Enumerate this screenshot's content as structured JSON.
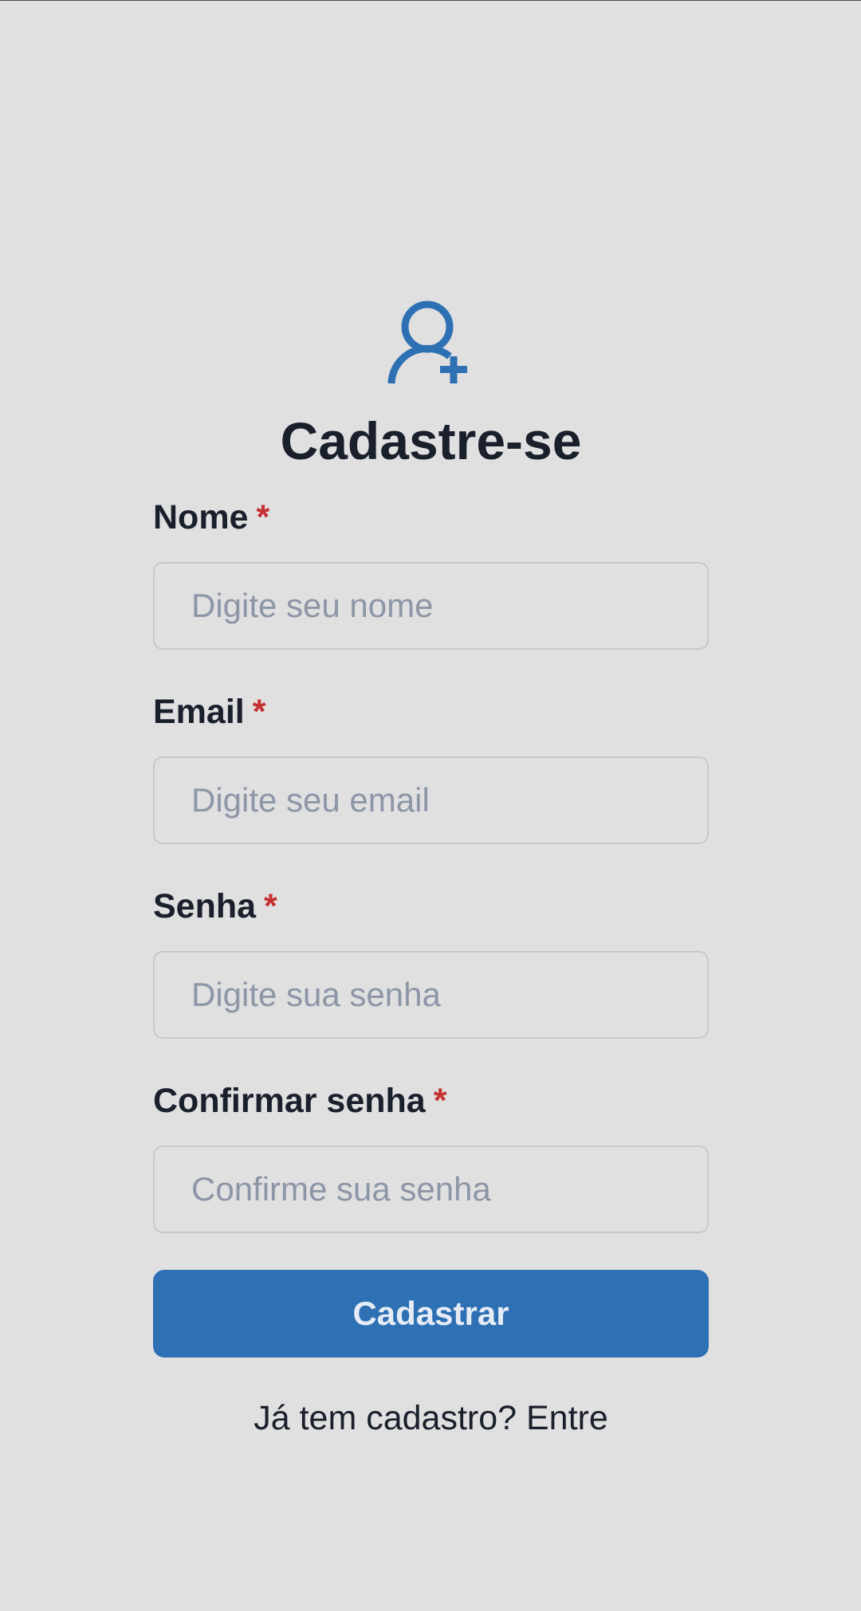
{
  "header": {
    "icon": "user-plus-icon",
    "title": "Cadastre-se"
  },
  "form": {
    "fields": [
      {
        "label": "Nome",
        "required_mark": "*",
        "placeholder": "Digite seu nome",
        "value": ""
      },
      {
        "label": "Email",
        "required_mark": "*",
        "placeholder": "Digite seu email",
        "value": ""
      },
      {
        "label": "Senha",
        "required_mark": "*",
        "placeholder": "Digite sua senha",
        "value": ""
      },
      {
        "label": "Confirmar senha",
        "required_mark": "*",
        "placeholder": "Confirme sua senha",
        "value": ""
      }
    ],
    "submit_label": "Cadastrar"
  },
  "footer": {
    "prompt": "Já tem cadastro?",
    "link_label": "Entre"
  },
  "colors": {
    "accent": "#2d70b3",
    "required": "#c53030",
    "background": "#e0e0e1",
    "text": "#1a1f2c",
    "placeholder": "#8c96a6"
  }
}
